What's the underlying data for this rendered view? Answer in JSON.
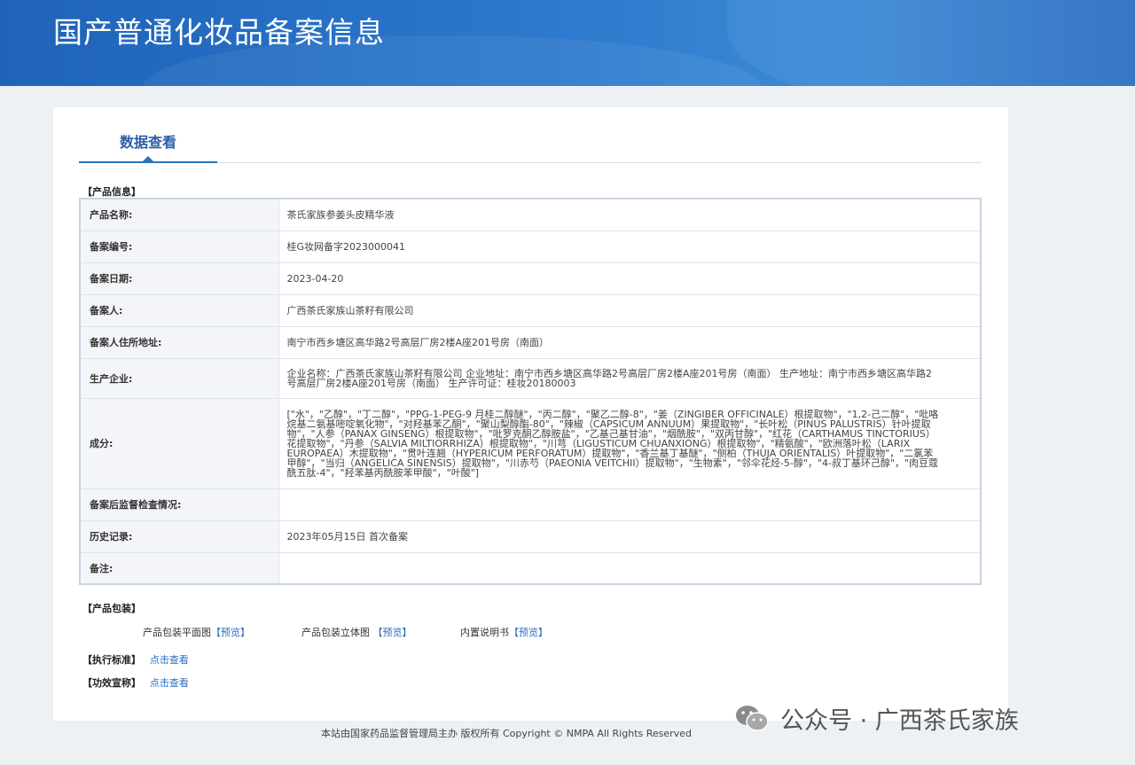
{
  "header": {
    "title": "国产普通化妆品备案信息"
  },
  "tab": {
    "label": "数据查看"
  },
  "sections": {
    "product_info": "【产品信息】",
    "packaging": "【产品包装】",
    "standard_label": "【执行标准】",
    "efficacy_label": "【功效宣称】"
  },
  "product_info": {
    "rows": [
      {
        "label": "产品名称:",
        "value": "茶氏家族参姜头皮精华液"
      },
      {
        "label": "备案编号:",
        "value": "桂G妆网备字2023000041"
      },
      {
        "label": "备案日期:",
        "value": "2023-04-20"
      },
      {
        "label": "备案人:",
        "value": "广西茶氏家族山茶籽有限公司"
      },
      {
        "label": "备案人住所地址:",
        "value": "南宁市西乡塘区高华路2号高层厂房2楼A座201号房（南面）"
      },
      {
        "label": "生产企业:",
        "value": "企业名称：广西茶氏家族山茶籽有限公司 企业地址：南宁市西乡塘区高华路2号高层厂房2楼A座201号房（南面） 生产地址：南宁市西乡塘区高华路2号高层厂房2楼A座201号房（南面） 生产许可证：桂妆20180003"
      },
      {
        "label": "成分:",
        "value": "[\"水\"，\"乙醇\"，\"丁二醇\"，\"PPG-1-PEG-9 月桂二醇醚\"，\"丙二醇\"，\"聚乙二醇-8\"，\"姜（ZINGIBER OFFICINALE）根提取物\"，\"1,2-己二醇\"，\"吡咯烷基二氨基嘧啶氧化物\"，\"对羟基苯乙酮\"，\"聚山梨醇酯-80\"，\"辣椒（CAPSICUM ANNUUM）果提取物\"，\"长叶松（PINUS PALUSTRIS）针叶提取物\"，\"人参（PANAX GINSENG）根提取物\"，\"吡罗克酮乙醇胺盐\"，\"乙基己基甘油\"，\"烟酰胺\"，\"双丙甘醇\"，\"红花（CARTHAMUS TINCTORIUS）花提取物\"，\"丹参（SALVIA MILTIORRHIZA）根提取物\"，\"川芎（LIGUSTICUM CHUANXIONG）根提取物\"，\"精氨酸\"，\"欧洲落叶松（LARIX EUROPAEA）木提取物\"，\"贯叶连翘（HYPERICUM PERFORATUM）提取物\"，\"香兰基丁基醚\"，\"侧柏（THUJA ORIENTALIS）叶提取物\"，\"二氯苯甲醇\"，\"当归（ANGELICA SINENSIS）提取物\"，\"川赤芍（PAEONIA VEITCHII）提取物\"，\"生物素\"，\"邻伞花烃-5-醇\"，\"4-叔丁基环己醇\"，\"肉豆蔻酰五肽-4\"，\"羟苯基丙酰胺苯甲酸\"，\"叶酸\"]"
      },
      {
        "label": "备案后监督检查情况:",
        "value": ""
      },
      {
        "label": "历史记录:",
        "value": "2023年05月15日 首次备案"
      },
      {
        "label": "备注:",
        "value": ""
      }
    ]
  },
  "packaging": {
    "items": [
      {
        "label": "产品包装平面图",
        "link": "预览"
      },
      {
        "label": "产品包装立体图",
        "link": "预览"
      },
      {
        "label": "内置说明书",
        "link": "预览"
      }
    ]
  },
  "links": {
    "standard": "点击查看",
    "efficacy": "点击查看"
  },
  "footer": {
    "text": "本站由国家药品监督管理局主办 版权所有 Copyright © NMPA All Rights Reserved"
  },
  "watermark": {
    "text": "公众号 · 广西茶氏家族"
  }
}
